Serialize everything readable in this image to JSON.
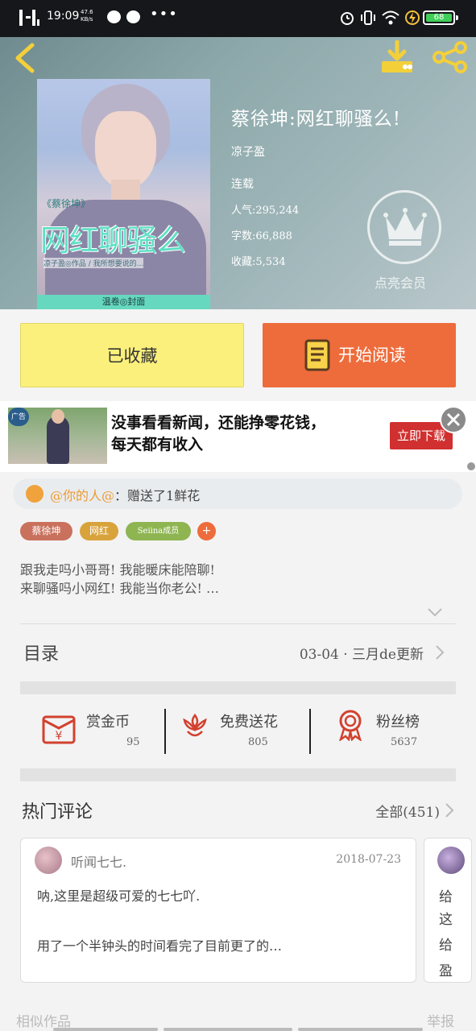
{
  "status_bar": {
    "time": "19:09",
    "net_speed": "47.6 KB/s",
    "battery": "68",
    "more": "•••"
  },
  "book": {
    "title": "蔡徐坤:网红聊骚么!",
    "author": "凉子盈",
    "status": "连载",
    "popularity": "人气:295,244",
    "word_count": "字数:66,888",
    "favorites": "收藏:5,534",
    "cover_title": "网红聊骚么",
    "cover_subtitle": "《蔡徐坤》",
    "cover_credit": "凉子盈◎作品 / 我所想要说的...",
    "cover_strip": "温卷◎封面",
    "vip_label": "点亮会员"
  },
  "actions": {
    "favorite_label": "已收藏",
    "read_label": "开始阅读"
  },
  "ad": {
    "text_line1": "没事看看新闻，还能挣零花钱，",
    "text_line2": "每天都有收入",
    "download_label": "立即下载",
    "tag": "广告"
  },
  "gift": {
    "user": "@你的人@",
    "message": "：赠送了1鲜花"
  },
  "tags": [
    {
      "label": "蔡徐坤",
      "color": "#c9715c"
    },
    {
      "label": "网红",
      "color": "#d9a33c"
    },
    {
      "label": "Seiina成员",
      "color": "#8eb551"
    }
  ],
  "tag_add": "+",
  "description": {
    "line1": "跟我走吗小哥哥! 我能暖床能陪聊!",
    "line2": "来聊骚吗小网红! 我能当你老公! …"
  },
  "toc": {
    "label": "目录",
    "update": "03-04 · 三月de更新"
  },
  "stats": [
    {
      "label": "赏金币",
      "value": "95",
      "icon": "red-envelope-icon"
    },
    {
      "label": "免费送花",
      "value": "805",
      "icon": "flower-icon"
    },
    {
      "label": "粉丝榜",
      "value": "5637",
      "icon": "medal-icon"
    }
  ],
  "comments": {
    "header": "热门评论",
    "all_label": "全部(451)",
    "items": [
      {
        "user": "听闻七七.",
        "date": "2018-07-23",
        "line1": "呐,这里是超级可爱的七七吖.",
        "line2": "用了一个半钟头的时间看完了目前更了的…"
      }
    ],
    "partial": [
      "给",
      "这",
      "给",
      "盈"
    ]
  },
  "footer": {
    "similar": "相似作品",
    "report": "举报"
  },
  "colors": {
    "accent_orange": "#ee6c3b",
    "favorite_yellow": "#fbf07c",
    "ad_button_red": "#d0302f"
  }
}
